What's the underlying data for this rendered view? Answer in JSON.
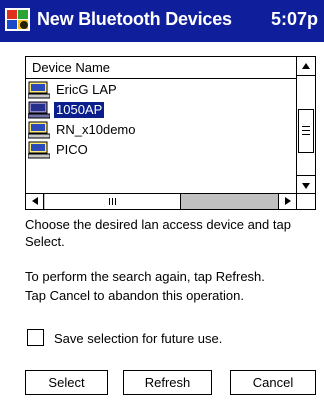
{
  "window": {
    "title": "New Bluetooth Devices",
    "clock": "5:07p"
  },
  "list": {
    "column_header": "Device Name",
    "items": [
      {
        "label": "EricG LAP",
        "selected": false
      },
      {
        "label": "1050AP",
        "selected": true
      },
      {
        "label": "RN_x10demo",
        "selected": false
      },
      {
        "label": "PICO",
        "selected": false
      }
    ]
  },
  "instructions": {
    "line1": "Choose the desired lan access device and tap Select.",
    "line2": "To perform the search again, tap Refresh.",
    "line3": "Tap Cancel to abandon this operation."
  },
  "save_checkbox": {
    "label": "Save selection for future use.",
    "checked": false
  },
  "buttons": {
    "select": "Select",
    "refresh": "Refresh",
    "cancel": "Cancel"
  },
  "colors": {
    "titlebar": "#0f1f9c",
    "selection": "#0a1f8c"
  }
}
